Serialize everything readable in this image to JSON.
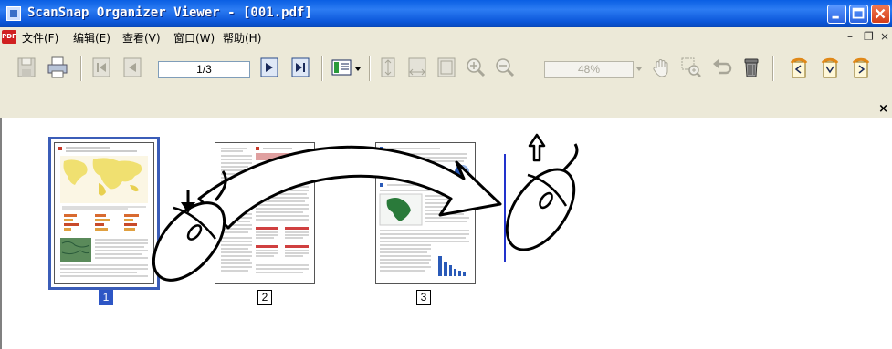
{
  "window": {
    "title": "ScanSnap Organizer Viewer - [001.pdf]"
  },
  "menubar": {
    "app_icon_text": "PDF",
    "items": [
      {
        "label": "文件(F)"
      },
      {
        "label": "编辑(E)"
      },
      {
        "label": "查看(V)"
      },
      {
        "label": "窗口(W)"
      },
      {
        "label": "帮助(H)"
      }
    ],
    "mdi_minimize": "–",
    "mdi_restore": "❐",
    "mdi_close": "×"
  },
  "toolbar": {
    "page_field_value": "1/3",
    "zoom_value": "48%"
  },
  "strip": {
    "close_label": "×"
  },
  "pages": [
    {
      "number": "1",
      "selected": true
    },
    {
      "number": "2",
      "selected": false
    },
    {
      "number": "3",
      "selected": false
    }
  ],
  "colors": {
    "selection": "#2d56c5",
    "drop_indicator": "#2233cc",
    "titlebar": "#0b56d9"
  }
}
